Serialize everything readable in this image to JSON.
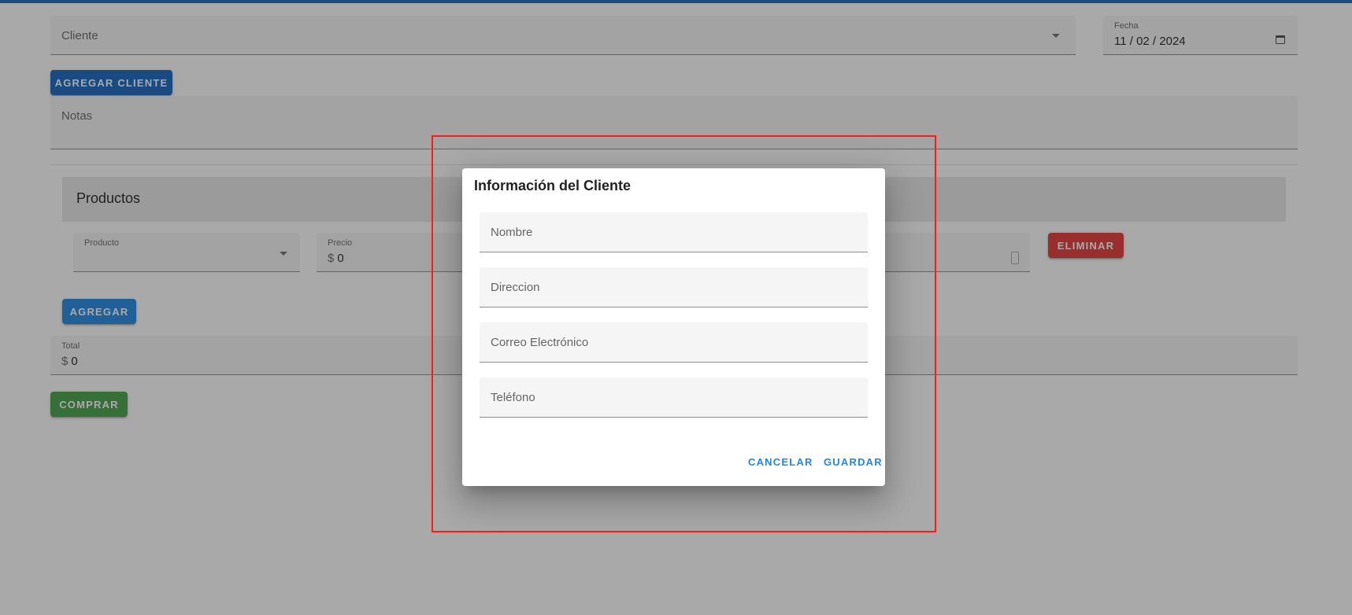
{
  "form": {
    "cliente_label": "Cliente",
    "fecha_label": "Fecha",
    "fecha_value": "11 / 02 / 2024",
    "agregar_cliente": "AGREGAR CLIENTE",
    "notas_label": "Notas"
  },
  "productos": {
    "title": "Productos",
    "producto_label": "Producto",
    "precio_label": "Precio",
    "precio_prefix": "$",
    "precio_value": "0",
    "eliminar": "ELIMINAR",
    "agregar": "AGREGAR"
  },
  "total": {
    "label": "Total",
    "prefix": "$",
    "value": "0",
    "comprar": "COMPRAR"
  },
  "dialog": {
    "title": "Información del Cliente",
    "fields": [
      "Nombre",
      "Direccion",
      "Correo Electrónico",
      "Teléfono"
    ],
    "cancel": "CANCELAR",
    "save": "GUARDAR"
  },
  "colors": {
    "primary_dark": "#1565c0",
    "primary": "#1e88e5",
    "danger": "#e53935",
    "success": "#43a047",
    "highlight": "#ff1a1a"
  },
  "icons": [
    "chevron-down-icon",
    "calendar-icon",
    "spin-icon"
  ]
}
